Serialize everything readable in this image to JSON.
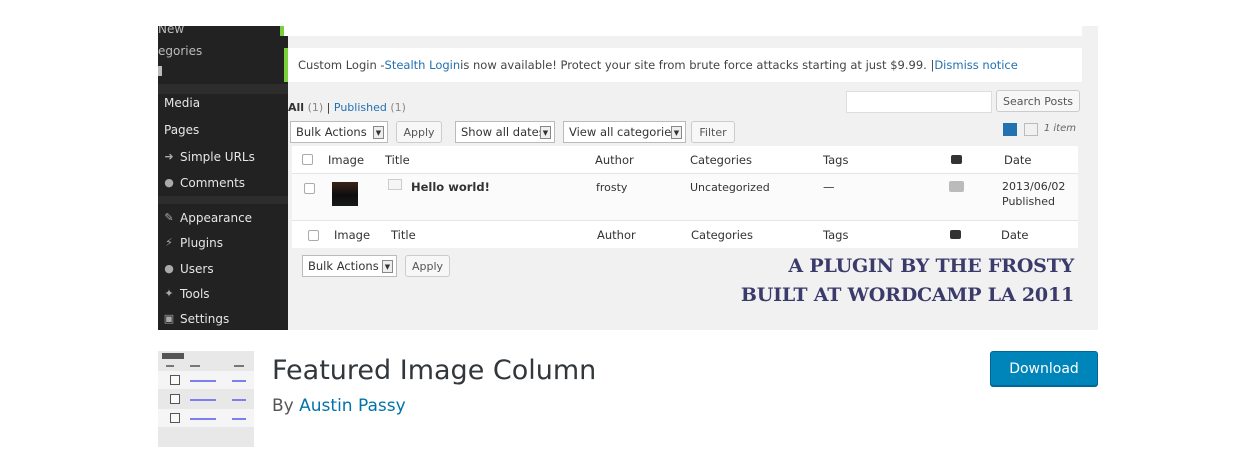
{
  "banner": {
    "sidebar": {
      "top_items": [
        "New",
        "egories"
      ],
      "items": [
        {
          "label": "Media",
          "icon": "media-icon"
        },
        {
          "label": "Pages",
          "icon": "pages-icon"
        },
        {
          "label": "Simple URLs",
          "icon": "link-icon"
        },
        {
          "label": "Comments",
          "icon": "comments-icon"
        },
        {
          "label": "Appearance",
          "icon": "appearance-icon"
        },
        {
          "label": "Plugins",
          "icon": "plugins-icon"
        },
        {
          "label": "Users",
          "icon": "users-icon"
        },
        {
          "label": "Tools",
          "icon": "tools-icon"
        },
        {
          "label": "Settings",
          "icon": "settings-icon"
        }
      ]
    },
    "notice": {
      "prefix": "Custom Login - ",
      "link": "Stealth Login",
      "text": " is now available! Protect your site from brute force attacks starting at just $9.99. | ",
      "dismiss": "Dismiss notice"
    },
    "filters": {
      "all": "All",
      "all_count": "(1)",
      "sep": "|",
      "published": "Published",
      "published_count": "(1)"
    },
    "search_button": "Search Posts",
    "bulk_actions": "Bulk Actions",
    "apply": "Apply",
    "show_all_dates": "Show all dates",
    "view_all_categories": "View all categories",
    "filter": "Filter",
    "items_count": "1 item",
    "columns": [
      "Image",
      "Title",
      "Author",
      "Categories",
      "Tags",
      "Date"
    ],
    "post": {
      "title": "Hello world!",
      "author": "frosty",
      "category": "Uncategorized",
      "tags": "—",
      "date": "2013/06/02",
      "status": "Published"
    },
    "tagline_1": "A PLUGIN BY THE FROSTY",
    "tagline_2": "BUILT AT WORDCAMP LA 2011"
  },
  "plugin": {
    "name": "Featured Image Column",
    "by": "By ",
    "author": "Austin Passy",
    "download": "Download"
  },
  "colors": {
    "accent": "#0085ba",
    "link": "#2271b1",
    "notice_border": "#7ad03a",
    "sidebar_bg": "#222222"
  }
}
